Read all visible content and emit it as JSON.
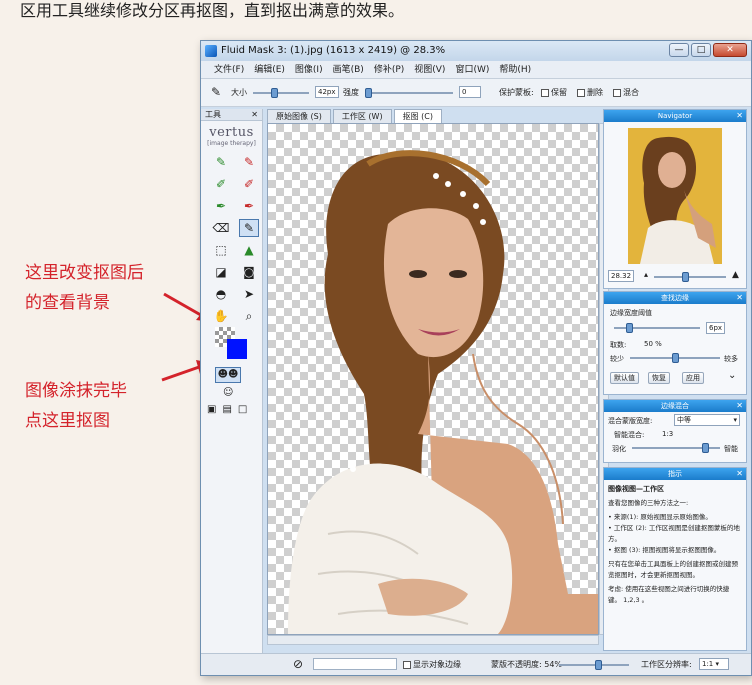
{
  "caption": "区用工具继续修改分区再抠图，直到抠出满意的效果。",
  "annotations": {
    "line1": "这里改变抠图后",
    "line2": "的查看背景",
    "line3": "图像涂抹完毕",
    "line4": "点这里抠图"
  },
  "window": {
    "title": "Fluid Mask 3: (1).jpg (1613 x 2419) @ 28.3%",
    "minimize": "—",
    "maximize": "□",
    "close": "✕"
  },
  "menu": [
    "文件(F)",
    "编辑(E)",
    "图像(I)",
    "画笔(B)",
    "修补(P)",
    "视图(V)",
    "窗口(W)",
    "帮助(H)"
  ],
  "toolbar": {
    "size_label": "大小",
    "size_value": "42px",
    "hardness_label": "强度",
    "hardness_value": "0",
    "protect_label": "保护蒙板:",
    "keep_label": "保留",
    "delete_label": "删除",
    "blend_label": "混合"
  },
  "tools": {
    "header": "工具",
    "logo": "vertus",
    "tagline": "[image therapy]"
  },
  "tabs": [
    "原始图像 (S)",
    "工作区 (W)",
    "抠图 (C)"
  ],
  "navigator": {
    "title": "Navigator",
    "zoom": "28.32"
  },
  "edge_panel": {
    "title": "查找边缘",
    "width_label": "边缘宽度阈值",
    "width_value": "6px",
    "count_label": "取数:",
    "count_value": "50 %",
    "less_label": "较少",
    "more_label": "较多",
    "default_btn": "默认值",
    "restore_btn": "恢复",
    "apply_btn": "应用"
  },
  "blend_panel": {
    "title": "边缘混合",
    "width_label": "混合蒙版宽度:",
    "width_value": "中等",
    "ratio_label": "智能混合:",
    "ratio_value": "1:3",
    "feather_label": "羽化",
    "smart_label": "智能"
  },
  "tips_panel": {
    "title": "指示",
    "heading": "图像视图—工作区",
    "intro": "查看您图像的三种方法之一:",
    "b1": "• 来源(1): 原始视图显示原始图像。",
    "b2": "• 工作区 (2): 工作区视图是创建抠图蒙板的地方。",
    "b3": "• 抠图 (3): 抠图视图将显示抠图图像。",
    "p1": "只有在您单击工具面板上的创建抠图或创建预览抠图时，才会更新抠图视图。",
    "p2": "考虑: 使用在这些视图之间进行切换的快捷键。 1,2,3 。"
  },
  "status": {
    "show_edge": "显示对象边缘",
    "opacity_label": "蒙版不透明度: 54%",
    "res_label": "工作区分辨率:",
    "res_value": "1:1"
  },
  "colors": {
    "accent": "#1b7ccb",
    "annotation": "#d4232b"
  }
}
